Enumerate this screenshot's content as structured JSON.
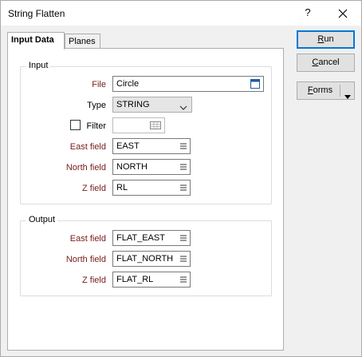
{
  "window": {
    "title": "String Flatten",
    "help_label": "?"
  },
  "tabs": [
    {
      "label": "Input Data",
      "active": true
    },
    {
      "label": "Planes",
      "active": false
    }
  ],
  "buttons": {
    "run": {
      "prefix": "",
      "accel": "R",
      "suffix": "un"
    },
    "cancel": {
      "prefix": "",
      "accel": "C",
      "suffix": "ancel"
    },
    "forms": {
      "prefix": "",
      "accel": "F",
      "suffix": "orms"
    }
  },
  "input_group": {
    "title": "Input",
    "file": {
      "label": "File",
      "value": "Circle",
      "icon": "file-browse-icon"
    },
    "type": {
      "label": "Type",
      "value": "STRING"
    },
    "filter": {
      "label": "Filter",
      "checked": false,
      "value": ""
    },
    "east_field": {
      "label": "East field",
      "value": "EAST"
    },
    "north_field": {
      "label": "North field",
      "value": "NORTH"
    },
    "z_field": {
      "label": "Z field",
      "value": "RL"
    }
  },
  "output_group": {
    "title": "Output",
    "east_field": {
      "label": "East field",
      "value": "FLAT_EAST"
    },
    "north_field": {
      "label": "North field",
      "value": "FLAT_NORTH"
    },
    "z_field": {
      "label": "Z field",
      "value": "FLAT_RL"
    }
  },
  "colors": {
    "required_label": "#7a1a1a",
    "default_button_border": "#0078d7",
    "file_icon": "#1e5aa8"
  }
}
